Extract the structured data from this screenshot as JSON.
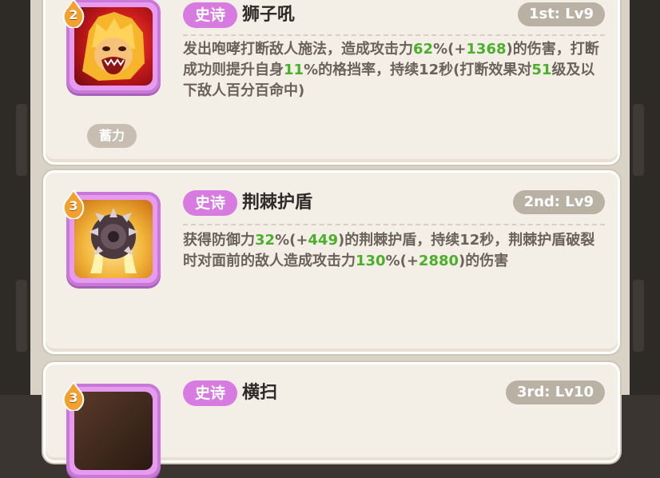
{
  "skills": [
    {
      "rank": "2",
      "tier": "史诗",
      "name": "狮子吼",
      "level": "1st: Lv9",
      "icon": "lion-roar-icon",
      "desc_parts": [
        {
          "t": "发出咆哮打断敌人施法，造成攻击力",
          "hl": false
        },
        {
          "t": "62",
          "hl": true
        },
        {
          "t": "%(+",
          "hl": false
        },
        {
          "t": "1368",
          "hl": true
        },
        {
          "t": ")的伤害，打断成功则提升自身",
          "hl": false
        },
        {
          "t": "11",
          "hl": true
        },
        {
          "t": "%的格挡率，持续12秒(打断效果对",
          "hl": false
        },
        {
          "t": "51",
          "hl": true
        },
        {
          "t": "级及以下敌人百分百命中)",
          "hl": false
        }
      ],
      "tag": "蓄力"
    },
    {
      "rank": "3",
      "tier": "史诗",
      "name": "荆棘护盾",
      "level": "2nd: Lv9",
      "icon": "thorn-shield-icon",
      "desc_parts": [
        {
          "t": "获得防御力",
          "hl": false
        },
        {
          "t": "32",
          "hl": true
        },
        {
          "t": "%(+",
          "hl": false
        },
        {
          "t": "449",
          "hl": true
        },
        {
          "t": ")的荆棘护盾，持续12秒，荆棘护盾破裂时对面前的敌人造成攻击力",
          "hl": false
        },
        {
          "t": "130",
          "hl": true
        },
        {
          "t": "%(+",
          "hl": false
        },
        {
          "t": "2880",
          "hl": true
        },
        {
          "t": ")的伤害",
          "hl": false
        }
      ]
    },
    {
      "rank": "3",
      "tier": "史诗",
      "name": "横扫",
      "level": "3rd: Lv10",
      "icon": "sweep-icon"
    }
  ],
  "colors": {
    "tier": "#d77be0",
    "highlight": "#4caf2c",
    "rank_badge": "#f2a12f"
  }
}
